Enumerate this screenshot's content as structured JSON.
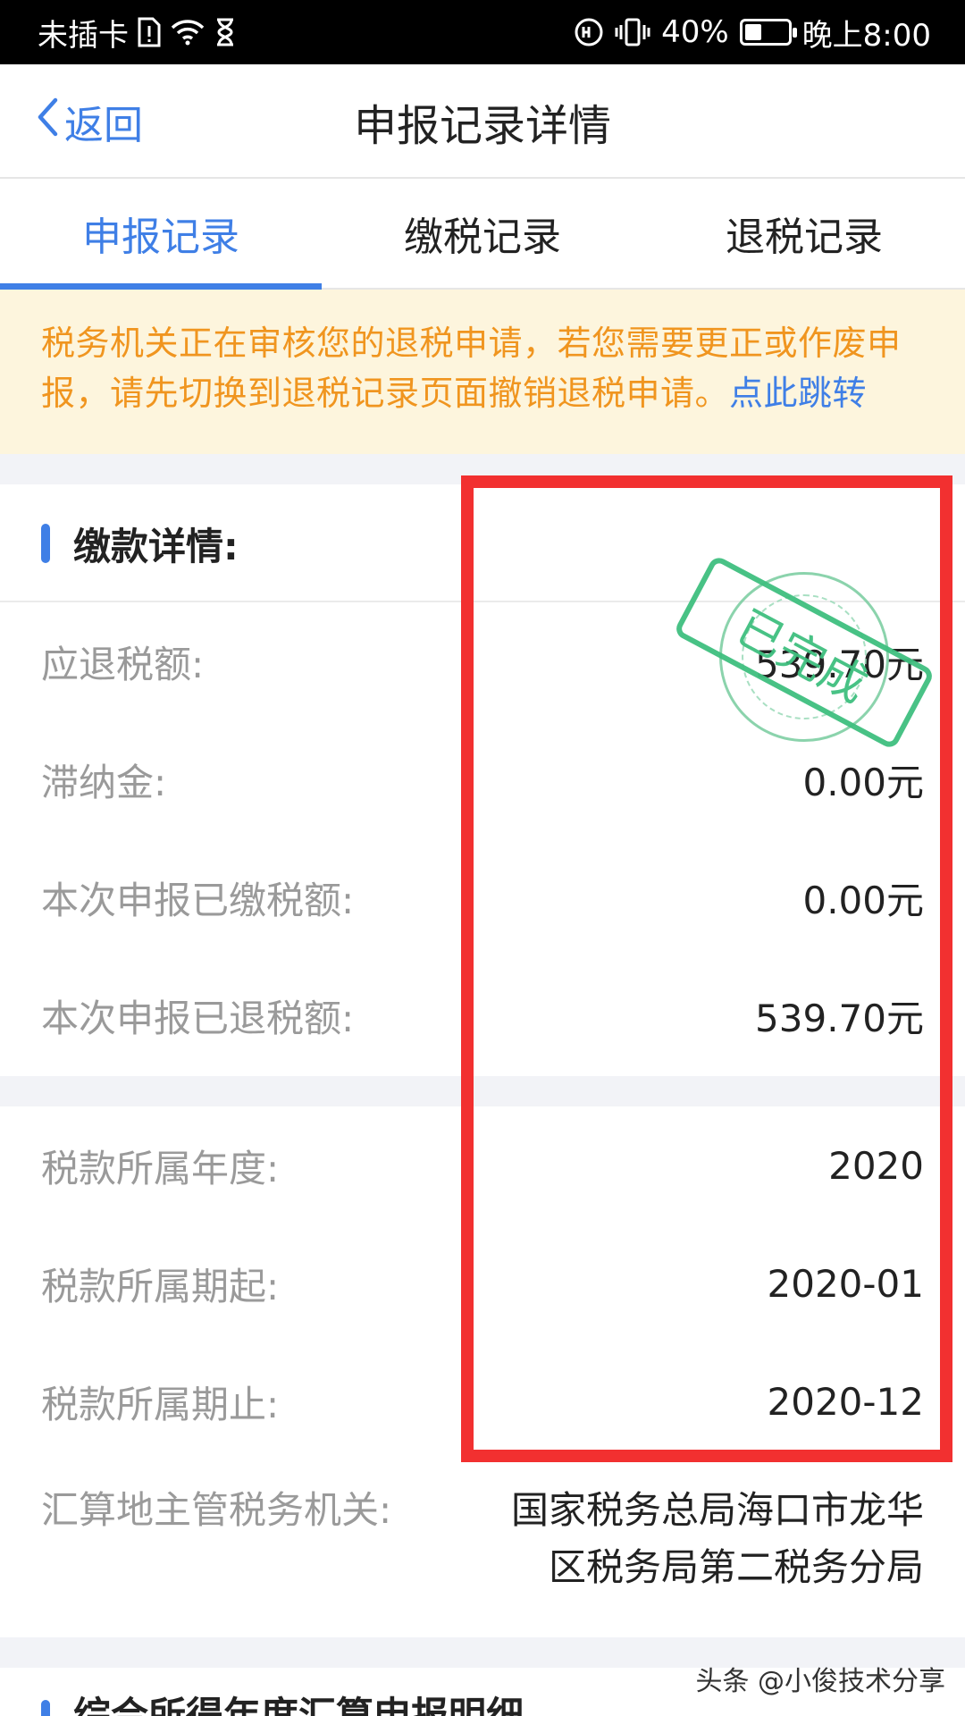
{
  "status_bar": {
    "carrier": "未插卡",
    "battery_percent": "40%",
    "battery_level": 0.4,
    "time": "晚上8:00",
    "icons": [
      "sim-alert-icon",
      "wifi-icon",
      "hourglass-icon",
      "hd-call-icon",
      "vibrate-icon",
      "battery-icon"
    ]
  },
  "nav": {
    "back_label": "返回",
    "title": "申报记录详情"
  },
  "tabs": [
    {
      "label": "申报记录",
      "active": true
    },
    {
      "label": "缴税记录",
      "active": false
    },
    {
      "label": "退税记录",
      "active": false
    }
  ],
  "notice": {
    "text": "税务机关正在审核您的退税申请，若您需要更正或作废申报，请先切换到退税记录页面撤销退税申请。",
    "link": "点此跳转"
  },
  "payment": {
    "title": "缴款详情:",
    "stamp_text": "已完成",
    "rows": [
      {
        "label": "应退税额:",
        "value": "539.70元"
      },
      {
        "label": "滞纳金:",
        "value": "0.00元"
      },
      {
        "label": "本次申报已缴税额:",
        "value": "0.00元"
      },
      {
        "label": "本次申报已退税额:",
        "value": "539.70元"
      }
    ]
  },
  "period": {
    "rows": [
      {
        "label": "税款所属年度:",
        "value": "2020"
      },
      {
        "label": "税款所属期起:",
        "value": "2020-01"
      },
      {
        "label": "税款所属期止:",
        "value": "2020-12"
      }
    ],
    "authority_label": "汇算地主管税务机关:",
    "authority_line1": "国家税务总局海口市龙华",
    "authority_line2": "区税务局第二税务分局"
  },
  "bottom_section_title": "综合所得年度汇算申报明细",
  "watermark": "头条 @小俊技术分享",
  "colors": {
    "accent": "#3f7fe6",
    "notice_text": "#f0951f",
    "notice_bg": "#fdf5dd",
    "stamp": "#3fbf7f",
    "highlight": "#f23030"
  }
}
